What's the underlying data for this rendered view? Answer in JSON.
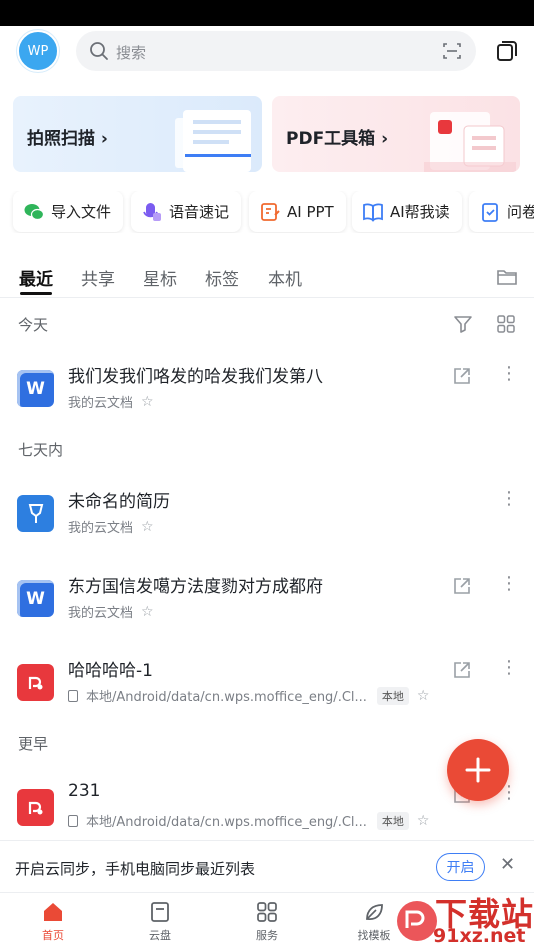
{
  "header": {
    "avatar_text": "WP",
    "search_placeholder": "搜索"
  },
  "cards": [
    {
      "label": "拍照扫描 ›"
    },
    {
      "label": "PDF工具箱 ›"
    }
  ],
  "chips": [
    {
      "label": "导入文件",
      "icon": "wechat-icon"
    },
    {
      "label": "语音速记",
      "icon": "voice-note-icon"
    },
    {
      "label": "AI PPT",
      "icon": "ai-ppt-icon"
    },
    {
      "label": "AI帮我读",
      "icon": "ai-read-icon"
    },
    {
      "label": "问卷",
      "icon": "survey-icon"
    }
  ],
  "tabs": [
    {
      "label": "最近",
      "active": true
    },
    {
      "label": "共享"
    },
    {
      "label": "星标"
    },
    {
      "label": "标签"
    },
    {
      "label": "本机"
    }
  ],
  "sections": {
    "today": "今天",
    "week": "七天内",
    "earlier": "更早"
  },
  "files": [
    {
      "name": "我们发我们咯发的哈发我们发第八",
      "meta": "我的云文档",
      "type": "word",
      "icon_text": "W"
    },
    {
      "name": "未命名的简历",
      "meta": "我的云文档",
      "type": "resume",
      "icon_text": ""
    },
    {
      "name": "东方国信发噶方法度勠对方成都府",
      "meta": "我的云文档",
      "type": "word",
      "icon_text": "W"
    },
    {
      "name": "哈哈哈哈-1",
      "meta": "本地/Android/data/cn.wps.moffice_eng/.Cl...",
      "badge": "本地",
      "type": "pdf",
      "icon_text": ""
    },
    {
      "name": "231",
      "meta": "本地/Android/data/cn.wps.moffice_eng/.Cl...",
      "badge": "本地",
      "type": "pdf",
      "icon_text": ""
    }
  ],
  "sync_bar": {
    "text": "开启云同步，手机电脑同步最近列表",
    "button": "开启",
    "close": "✕"
  },
  "bottom_nav": [
    {
      "label": "首页",
      "active": true
    },
    {
      "label": "云盘"
    },
    {
      "label": "服务"
    },
    {
      "label": "找模板"
    }
  ],
  "watermark": {
    "text": "下载站",
    "url": "91xz.net"
  },
  "colors": {
    "accent_red": "#ea4a36",
    "word_blue": "#2f6fe0",
    "pdf_red": "#e8383d",
    "link_blue": "#3e7ef5"
  }
}
